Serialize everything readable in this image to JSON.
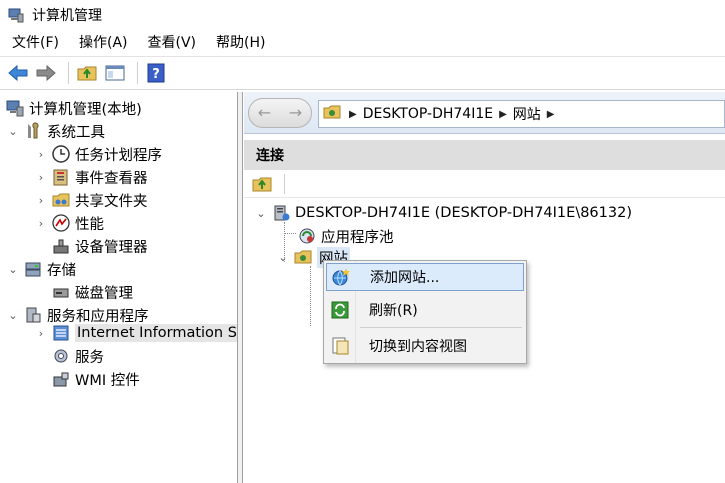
{
  "window": {
    "title": "计算机管理"
  },
  "menu": [
    "文件(F)",
    "操作(A)",
    "查看(V)",
    "帮助(H)"
  ],
  "tree": {
    "root": "计算机管理(本地)",
    "system_tools": "系统工具",
    "task_scheduler": "任务计划程序",
    "event_viewer": "事件查看器",
    "shared_folders": "共享文件夹",
    "performance": "性能",
    "device_manager": "设备管理器",
    "storage": "存储",
    "disk_management": "磁盘管理",
    "services_apps": "服务和应用程序",
    "iis": "Internet Information Se",
    "services": "服务",
    "wmi": "WMI 控件"
  },
  "address": {
    "crumbs": [
      "DESKTOP-DH74I1E",
      "网站"
    ]
  },
  "connections": {
    "header": "连接",
    "server": "DESKTOP-DH74I1E (DESKTOP-DH74I1E\\86132)",
    "app_pools": "应用程序池",
    "sites": "网站"
  },
  "context_menu": {
    "add_site": "添加网站...",
    "refresh": "刷新(R)",
    "switch_content": "切换到内容视图"
  }
}
